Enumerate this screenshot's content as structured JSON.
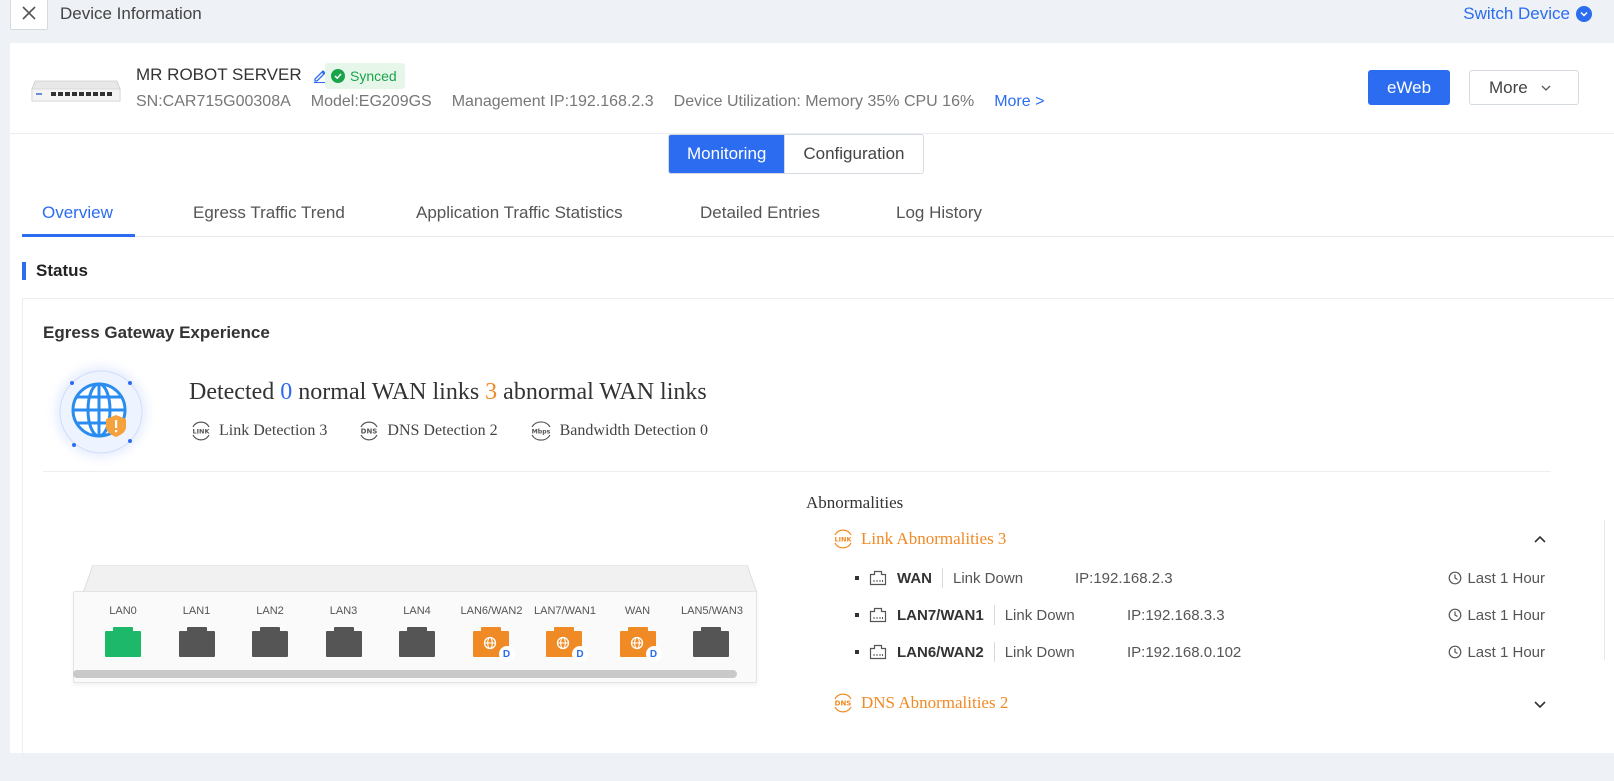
{
  "topbar": {
    "title": "Device Information",
    "switch_device": "Switch Device"
  },
  "device": {
    "name": "MR ROBOT SERVER",
    "status": "Synced",
    "sn": "SN:CAR715G00308A",
    "model": "Model:EG209GS",
    "management_ip": "Management IP:192.168.2.3",
    "utilization": "Device Utilization: Memory 35% CPU 16%",
    "more_link": "More >",
    "eweb_label": "eWeb",
    "more_label": "More"
  },
  "modes": {
    "monitoring": "Monitoring",
    "configuration": "Configuration"
  },
  "tabs": [
    {
      "label": "Overview"
    },
    {
      "label": "Egress Traffic Trend"
    },
    {
      "label": "Application Traffic Statistics"
    },
    {
      "label": "Detailed Entries"
    },
    {
      "label": "Log History"
    }
  ],
  "status": {
    "title": "Status",
    "card_title": "Egress Gateway Experience",
    "detected_prefix": "Detected",
    "normal_count": "0",
    "normal_text": "normal WAN links",
    "abnormal_count": "3",
    "abnormal_text": "abnormal WAN links",
    "link_detection": "Link Detection 3",
    "dns_detection": "DNS Detection 2",
    "bandwidth_detection": "Bandwidth Detection 0"
  },
  "ports": [
    {
      "label": "LAN0",
      "state": "up"
    },
    {
      "label": "LAN1",
      "state": "down"
    },
    {
      "label": "LAN2",
      "state": "down"
    },
    {
      "label": "LAN3",
      "state": "down"
    },
    {
      "label": "LAN4",
      "state": "down"
    },
    {
      "label": "LAN6/WAN2",
      "state": "wan-abnormal"
    },
    {
      "label": "LAN7/WAN1",
      "state": "wan-abnormal"
    },
    {
      "label": "WAN",
      "state": "wan-abnormal"
    },
    {
      "label": "LAN5/WAN3",
      "state": "down"
    }
  ],
  "d_badge": "D",
  "abnormalities": {
    "title": "Abnormalities",
    "link_section": "Link Abnormalities 3",
    "dns_section": "DNS Abnormalities 2",
    "rows": [
      {
        "port": "WAN",
        "status": "Link Down",
        "ip": "IP:192.168.2.3",
        "time": "Last 1 Hour"
      },
      {
        "port": "LAN7/WAN1",
        "status": "Link Down",
        "ip": "IP:192.168.3.3",
        "time": "Last 1 Hour"
      },
      {
        "port": "LAN6/WAN2",
        "status": "Link Down",
        "ip": "IP:192.168.0.102",
        "time": "Last 1 Hour"
      }
    ]
  },
  "colors": {
    "accent": "#2b6cf0",
    "warning": "#f08a24",
    "success": "#1aa34a",
    "port_down": "#555555",
    "port_up": "#1db86a"
  }
}
